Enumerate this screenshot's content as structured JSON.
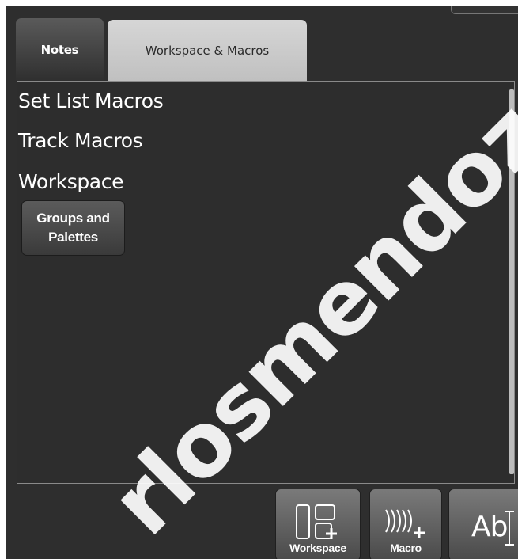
{
  "tabs": [
    {
      "label": "Notes",
      "active": false
    },
    {
      "label": "Workspace & Macros",
      "active": true
    }
  ],
  "content": {
    "set_list_macros": "Set List Macros",
    "track_macros": "Track Macros",
    "workspace_heading": "Workspace",
    "workspace_button": "Groups and Palettes"
  },
  "toolbar": {
    "workspace_label": "Workspace",
    "macro_label": "Macro",
    "text_icon_label": "Ab"
  },
  "watermark": "rlosmendoz",
  "colors": {
    "panel_bg": "#2e2e2e",
    "active_tab": "#c8c8c8",
    "text": "#ffffff"
  }
}
